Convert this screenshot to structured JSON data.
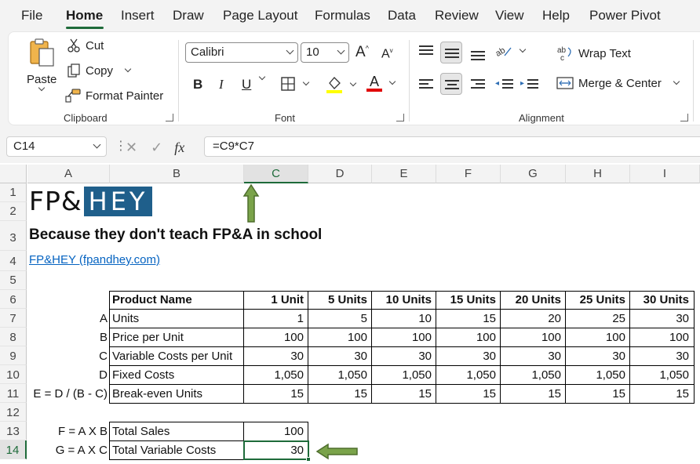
{
  "menu": {
    "tabs": [
      "File",
      "Home",
      "Insert",
      "Draw",
      "Page Layout",
      "Formulas",
      "Data",
      "Review",
      "View",
      "Help",
      "Power Pivot"
    ],
    "active": "Home"
  },
  "ribbon": {
    "clipboard": {
      "paste": "Paste",
      "cut": "Cut",
      "copy": "Copy",
      "format_painter": "Format Painter",
      "label": "Clipboard"
    },
    "font": {
      "font_name": "Calibri",
      "font_size": "10",
      "grow": "A",
      "shrink": "A",
      "bold": "B",
      "italic": "I",
      "underline": "U",
      "font_color_letter": "A",
      "label": "Font",
      "highlight_color": "#ffff00",
      "font_color": "#e00000"
    },
    "alignment": {
      "wrap_text": "Wrap Text",
      "merge_center": "Merge & Center",
      "label": "Alignment"
    }
  },
  "formula_bar": {
    "name_box": "C14",
    "fx": "fx",
    "formula": "=C9*C7"
  },
  "grid": {
    "columns": [
      "A",
      "B",
      "C",
      "D",
      "E",
      "F",
      "G",
      "H",
      "I"
    ],
    "selected_column": "C",
    "rows": [
      "1",
      "2",
      "3",
      "4",
      "5",
      "6",
      "7",
      "8",
      "9",
      "10",
      "11",
      "12",
      "13",
      "14"
    ],
    "selected_row": "14"
  },
  "sheet": {
    "logo_left": "FP&",
    "logo_right": "HEY",
    "tagline": "Because they don't teach FP&A in school",
    "link": "FP&HEY (fpandhey.com)",
    "table": {
      "headers": [
        "Product Name",
        "1 Unit",
        "5 Units",
        "10 Units",
        "15 Units",
        "20 Units",
        "25 Units",
        "30 Units"
      ],
      "rows": [
        {
          "key": "A",
          "name": "Units",
          "values": [
            "1",
            "5",
            "10",
            "15",
            "20",
            "25",
            "30"
          ]
        },
        {
          "key": "B",
          "name": "Price per Unit",
          "values": [
            "100",
            "100",
            "100",
            "100",
            "100",
            "100",
            "100"
          ]
        },
        {
          "key": "C",
          "name": "Variable Costs per Unit",
          "values": [
            "30",
            "30",
            "30",
            "30",
            "30",
            "30",
            "30"
          ]
        },
        {
          "key": "D",
          "name": "Fixed Costs",
          "values": [
            "1,050",
            "1,050",
            "1,050",
            "1,050",
            "1,050",
            "1,050",
            "1,050"
          ]
        },
        {
          "key": "E = D / (B - C)",
          "name": "Break-even Units",
          "values": [
            "15",
            "15",
            "15",
            "15",
            "15",
            "15",
            "15"
          ]
        }
      ]
    },
    "small_table": [
      {
        "key": "F = A X B",
        "name": "Total Sales",
        "value": "100"
      },
      {
        "key": "G = A X C",
        "name": "Total Variable Costs",
        "value": "30"
      }
    ],
    "logo_color": "#1f5f8b",
    "arrow_color": "#7aa34a"
  }
}
